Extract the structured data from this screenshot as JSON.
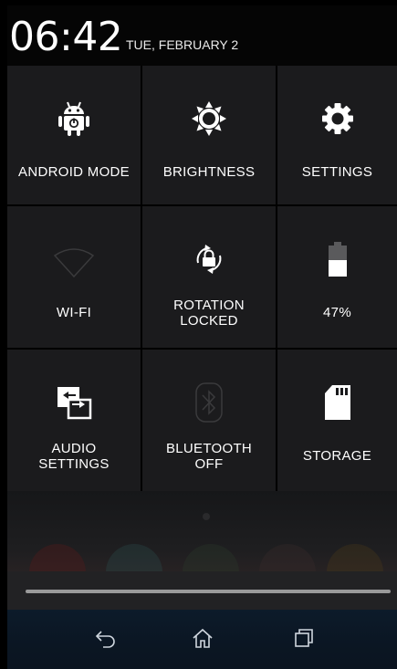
{
  "status": {
    "time": "06:42",
    "date": "TUE, FEBRUARY 2"
  },
  "tiles": [
    {
      "label_lines": [
        "ANDROID MODE"
      ],
      "icon": "android-icon"
    },
    {
      "label_lines": [
        "BRIGHTNESS"
      ],
      "icon": "brightness-icon"
    },
    {
      "label_lines": [
        "SETTINGS"
      ],
      "icon": "gear-icon"
    },
    {
      "label_lines": [
        "WI-FI"
      ],
      "icon": "wifi-icon"
    },
    {
      "label_lines": [
        "ROTATION",
        "LOCKED"
      ],
      "icon": "rotation-lock-icon"
    },
    {
      "label_lines": [
        "47%"
      ],
      "icon": "battery-icon",
      "level": 0.47
    },
    {
      "label_lines": [
        "AUDIO",
        "SETTINGS"
      ],
      "icon": "audio-settings-icon"
    },
    {
      "label_lines": [
        "BLUETOOTH",
        "OFF"
      ],
      "icon": "bluetooth-icon"
    },
    {
      "label_lines": [
        "STORAGE"
      ],
      "icon": "sd-card-icon"
    }
  ],
  "navbar": {
    "buttons": [
      "back-icon",
      "home-icon",
      "recents-icon"
    ]
  },
  "colors": {
    "tile_bg": "#1b1b1d",
    "inactive_icon": "#3a3a3c",
    "active_icon": "#ffffff"
  }
}
